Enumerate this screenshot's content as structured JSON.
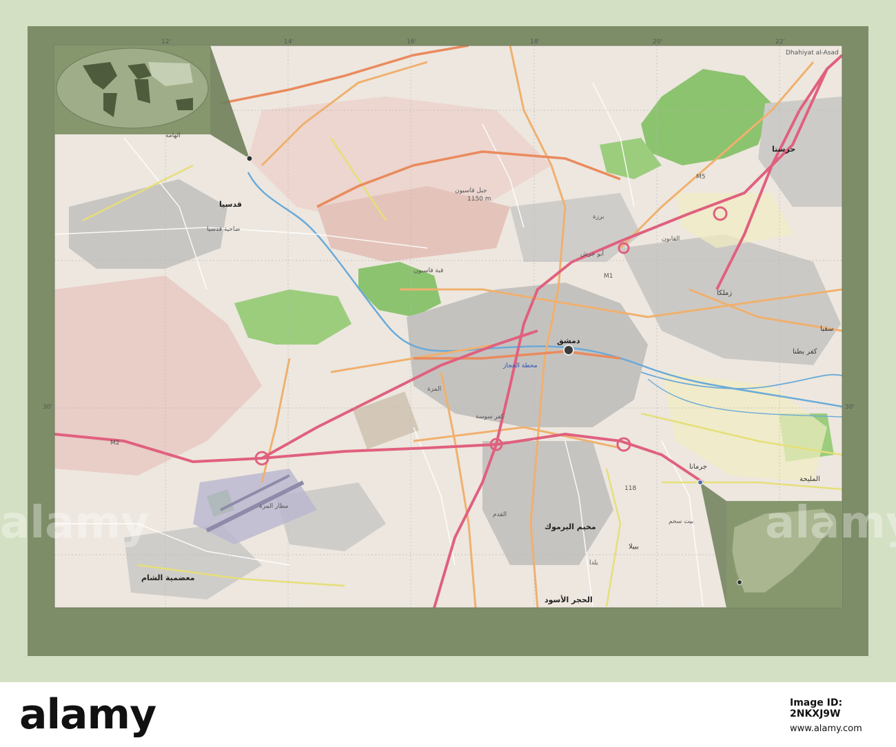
{
  "map": {
    "city_labels": [
      {
        "id": "damascus",
        "text": "دمشق"
      },
      {
        "id": "harasta",
        "text": "حرستا"
      },
      {
        "id": "douma",
        "text": "Dhahiyat al-Asad"
      },
      {
        "id": "zamalka",
        "text": "زملكا"
      },
      {
        "id": "saqba",
        "text": "سقبا"
      },
      {
        "id": "kafr_batna",
        "text": "كفر بطنا"
      },
      {
        "id": "jaramana",
        "text": "جرمانا"
      },
      {
        "id": "al_maliha",
        "text": "المليحة"
      },
      {
        "id": "yarmouk",
        "text": "مخيم اليرموك"
      },
      {
        "id": "hajar_aswad",
        "text": "الحجر الأسود"
      },
      {
        "id": "muadamiyat",
        "text": "معضمية الشام"
      },
      {
        "id": "qudsaya",
        "text": "قدسيا"
      },
      {
        "id": "babila",
        "text": "ببيلا"
      },
      {
        "id": "yalda",
        "text": "يلدا"
      },
      {
        "id": "abu_jarash",
        "text": "أبو جرش"
      },
      {
        "id": "qasioun",
        "text": "قبة قاسيون"
      },
      {
        "id": "jabal",
        "text": "جبل قاسيون"
      },
      {
        "id": "elevation",
        "text": "1150 m"
      },
      {
        "id": "mezze_airport",
        "text": "مطار المزة"
      },
      {
        "id": "hama",
        "text": "الهامة"
      },
      {
        "id": "station",
        "text": "محطة الحجاز"
      },
      {
        "id": "m1",
        "text": "M1"
      },
      {
        "id": "m2",
        "text": "M2"
      },
      {
        "id": "m5",
        "text": "M5"
      },
      {
        "id": "r118",
        "text": "118"
      },
      {
        "id": "qaboun",
        "text": "القابون"
      },
      {
        "id": "barzeh",
        "text": "برزة"
      },
      {
        "id": "mezzeh",
        "text": "المزة"
      },
      {
        "id": "kafr_sousa",
        "text": "كفر سوسة"
      },
      {
        "id": "dahiya",
        "text": "ضاحية قدسيا"
      },
      {
        "id": "beit_sahem",
        "text": "بيت سحم"
      },
      {
        "id": "qadam",
        "text": "القدم"
      }
    ],
    "graticule_labels": {
      "lon_12": "12'",
      "lon_14": "14'",
      "lon_16": "16'",
      "lon_18": "18'",
      "lon_20": "20'",
      "lon_22": "22'",
      "lat_30": "30'",
      "lat_30_right": "30'"
    },
    "colors": {
      "frame": "#d4e0c3",
      "panel": "#7d8d68",
      "map_base": "#ede7df",
      "forest": "#8cc36f",
      "motorway": "#e0607e",
      "trunk": "#f2a57a",
      "primary": "#f5c97c",
      "secondary": "#f6f1a6",
      "urban": "#bdbdbd",
      "river": "#6aaad8",
      "pink_zone": "#e8c6c1"
    },
    "inset_world": {
      "label": "world-locator"
    },
    "inset_country": {
      "label": "syria-locator"
    },
    "marker": {
      "label": "damascus-marker"
    }
  },
  "footer": {
    "brand": "alamy",
    "image_id": "Image ID: 2NKXJ9W",
    "site": "www.alamy.com"
  },
  "watermarks": [
    "alamy",
    "alamy"
  ]
}
